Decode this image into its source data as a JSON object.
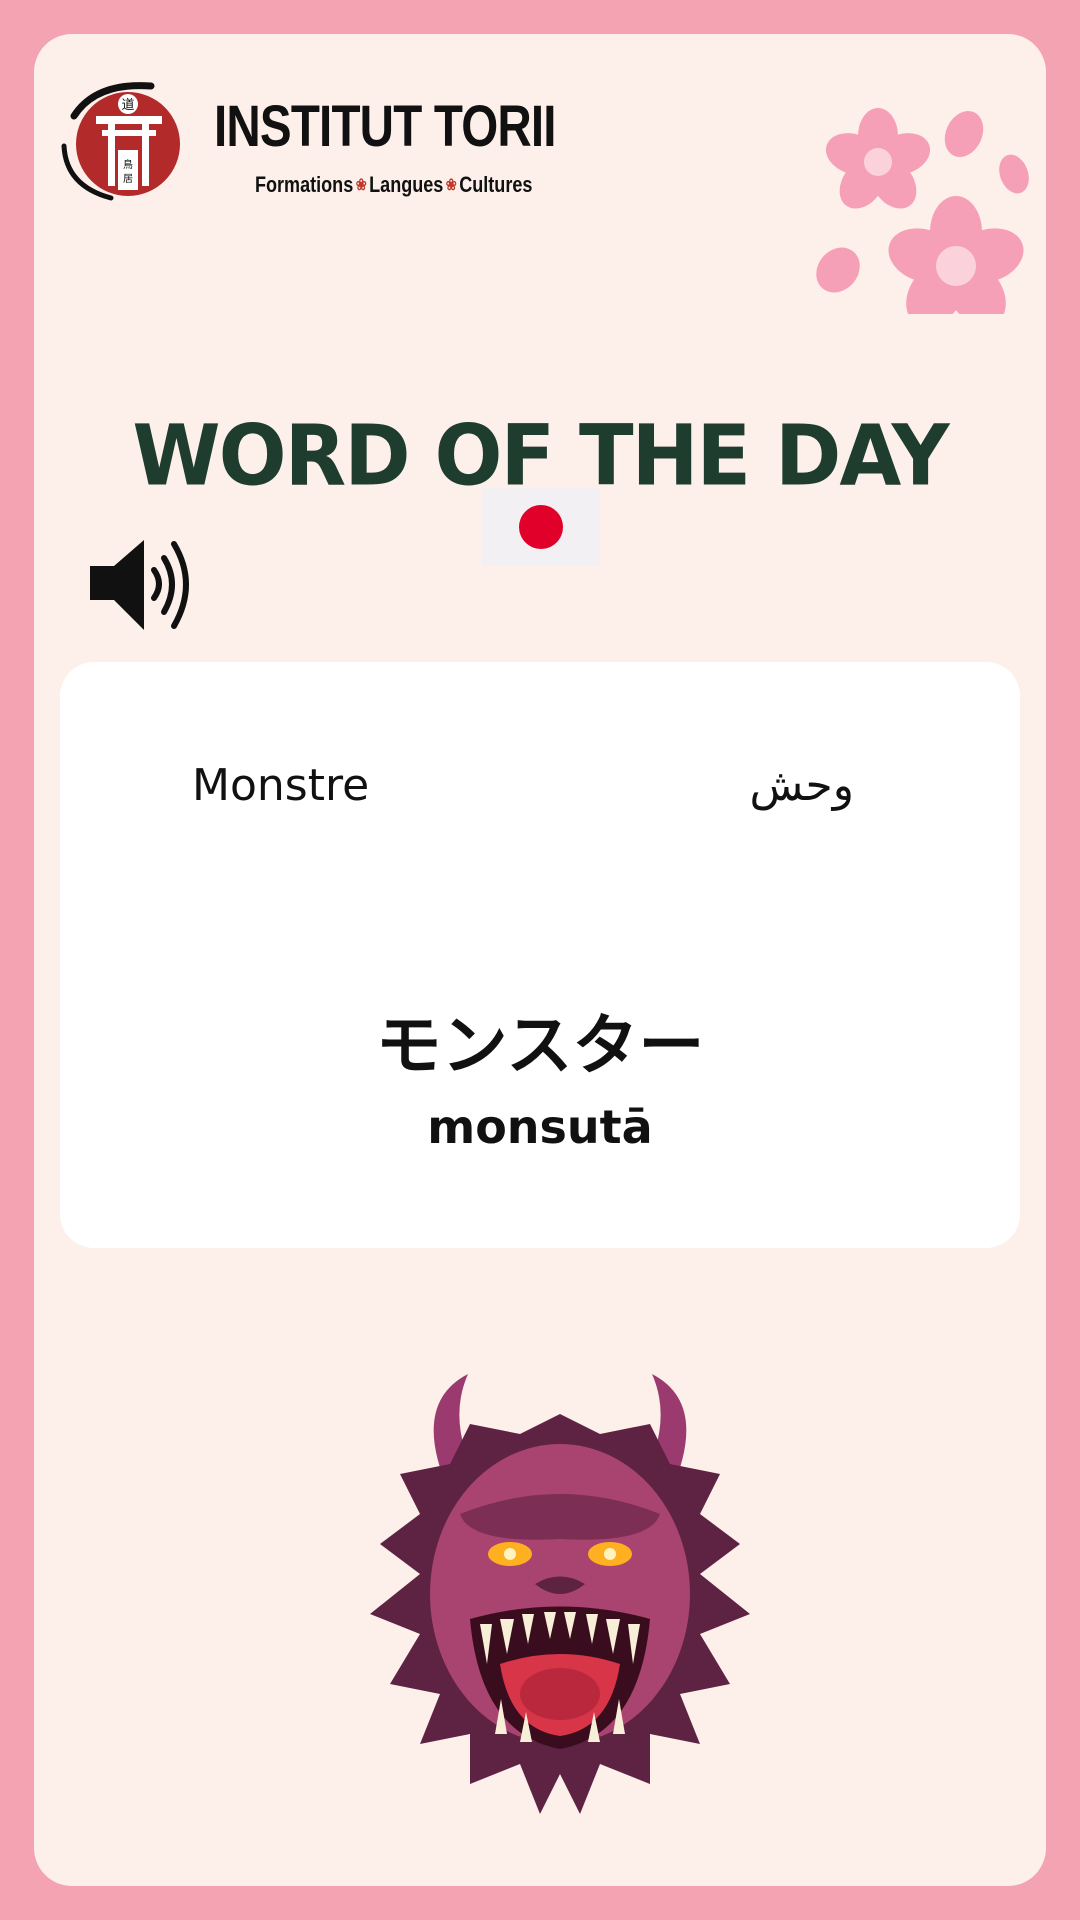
{
  "brand": {
    "name": "INSTITUT TORII",
    "tagline_items": [
      "Formations",
      "Langues",
      "Cultures"
    ],
    "seal_text": "道 鳥居"
  },
  "title": "WORD OF THE DAY",
  "flag_icon": "japan-flag-icon",
  "audio_icon": "speaker-icon",
  "word": {
    "french": "Monstre",
    "arabic": "وحش",
    "japanese": "モンスター",
    "romaji": "monsutā"
  },
  "illustration": "monster-head",
  "colors": {
    "frame": "#f4a3b2",
    "card": "#fdf0ea",
    "title": "#1f3d2e",
    "flag_red": "#e0002a",
    "seal_red": "#b22a2a"
  }
}
